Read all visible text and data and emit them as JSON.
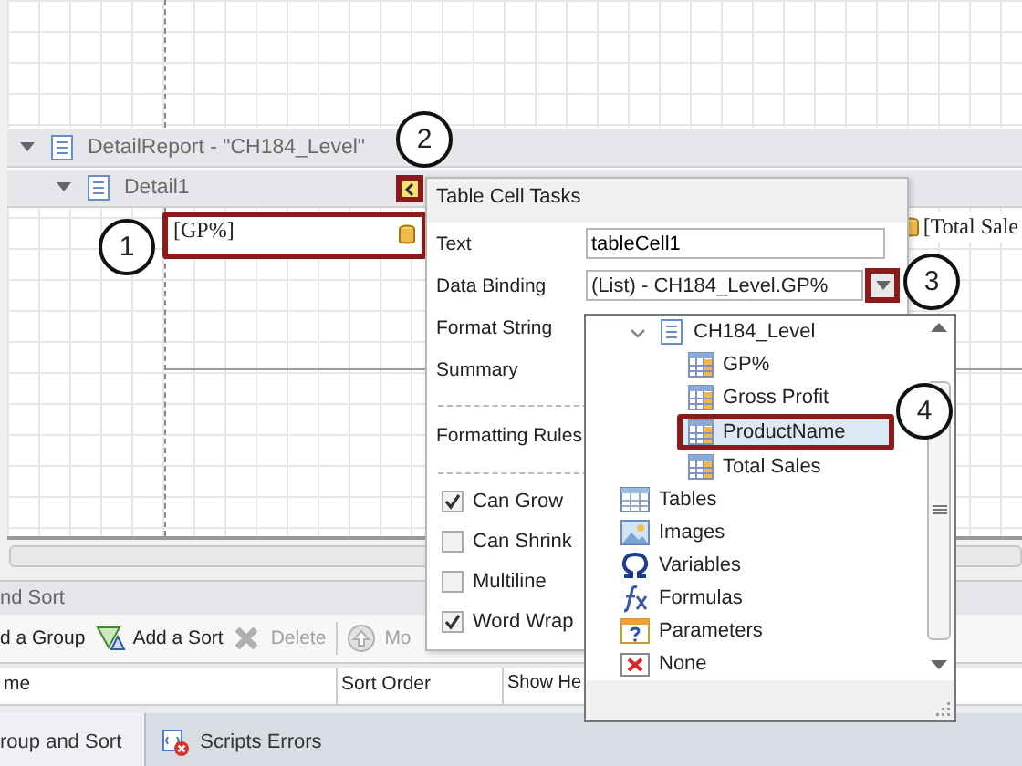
{
  "designer": {
    "bands": [
      {
        "label": "DetailReport - \"CH184_Level\"",
        "expanded": true
      },
      {
        "label": "Detail1",
        "expanded": true
      }
    ],
    "cells": [
      {
        "text": "[GP%]",
        "selected": true
      },
      {
        "text": "[Total Sale",
        "selected": false
      }
    ]
  },
  "smart_tag": {
    "title": "Table Cell Tasks",
    "fields": [
      {
        "label": "Text",
        "value": "tableCell1",
        "kind": "text"
      },
      {
        "label": "Data Binding",
        "value": "(List) - CH184_Level.GP%",
        "kind": "combo"
      },
      {
        "label": "Format String",
        "kind": "empty"
      },
      {
        "label": "Summary",
        "kind": "empty"
      }
    ],
    "formatting_rules": "Formatting Rules",
    "options": [
      {
        "label": "Can Grow",
        "checked": true
      },
      {
        "label": "Can Shrink",
        "checked": false
      },
      {
        "label": "Multiline",
        "checked": false
      },
      {
        "label": "Word Wrap",
        "checked": true
      }
    ]
  },
  "binding_dropdown": {
    "items": [
      {
        "label": "CH184_Level",
        "kind": "source",
        "expanded": true,
        "children": [
          {
            "label": "GP%",
            "kind": "field",
            "selected": false
          },
          {
            "label": "Gross Profit",
            "kind": "field",
            "selected": false
          },
          {
            "label": "ProductName",
            "kind": "field",
            "selected": true
          },
          {
            "label": "Total Sales",
            "kind": "field",
            "selected": false
          }
        ]
      },
      {
        "label": "Tables",
        "kind": "tables"
      },
      {
        "label": "Images",
        "kind": "images"
      },
      {
        "label": "Variables",
        "kind": "variables"
      },
      {
        "label": "Formulas",
        "kind": "formulas"
      },
      {
        "label": "Parameters",
        "kind": "parameters"
      },
      {
        "label": "None",
        "kind": "none"
      }
    ]
  },
  "group_sort": {
    "title": "nd Sort",
    "toolbar": [
      {
        "label": "d a Group",
        "kind": "add-group",
        "disabled": false
      },
      {
        "label": "Add a Sort",
        "kind": "add-sort",
        "disabled": false
      },
      {
        "label": "Delete",
        "kind": "delete",
        "disabled": true
      },
      {
        "label": "Mo",
        "kind": "move-up",
        "disabled": true
      }
    ],
    "columns": [
      "me",
      "Sort Order",
      "Show He"
    ]
  },
  "bottom_tabs": [
    {
      "label": "roup and Sort",
      "selected": true,
      "kind": "plain"
    },
    {
      "label": "Scripts Errors",
      "selected": false,
      "kind": "errors"
    }
  ],
  "callouts": [
    "1",
    "2",
    "3",
    "4"
  ]
}
